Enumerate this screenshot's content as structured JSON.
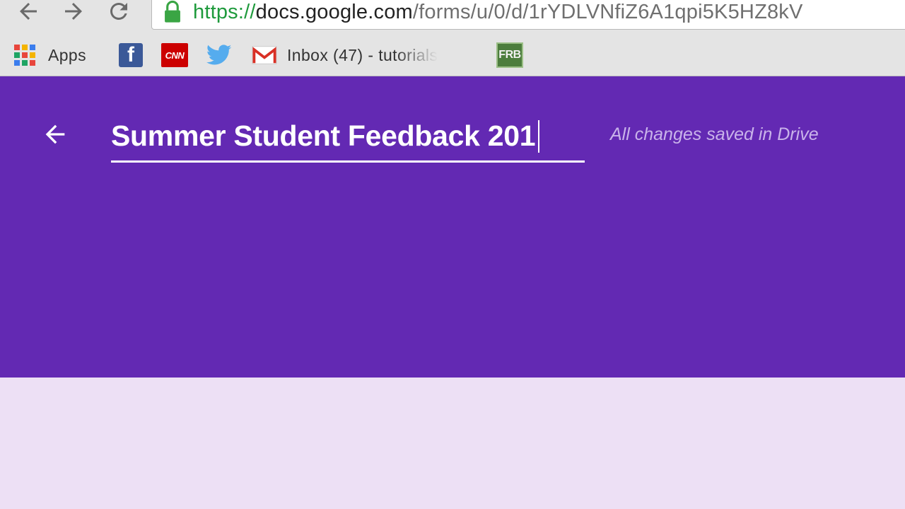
{
  "browser": {
    "url": {
      "scheme": "https://",
      "host": "docs.google.com",
      "path": "/forms/u/0/d/1rYDLVNfiZ6A1qpi5K5HZ8kV"
    },
    "bookmarks": [
      {
        "label": "Apps",
        "icon": "apps-grid-icon"
      },
      {
        "label": "",
        "icon": "facebook-icon",
        "icon_text": "f"
      },
      {
        "label": "",
        "icon": "cnn-icon",
        "icon_text": "CNN"
      },
      {
        "label": "",
        "icon": "twitter-icon"
      },
      {
        "label": "Inbox (47) - tutorials",
        "icon": "gmail-icon"
      },
      {
        "label": "",
        "icon": "frb-icon",
        "icon_text": "FRB"
      }
    ]
  },
  "form": {
    "title": "Summer Student Feedback 201",
    "save_status": "All changes saved in Drive"
  },
  "colors": {
    "header": "#6329b3",
    "background": "#ede0f5",
    "save_status": "#c9b3ea",
    "url_secure": "#1e9a3c"
  }
}
